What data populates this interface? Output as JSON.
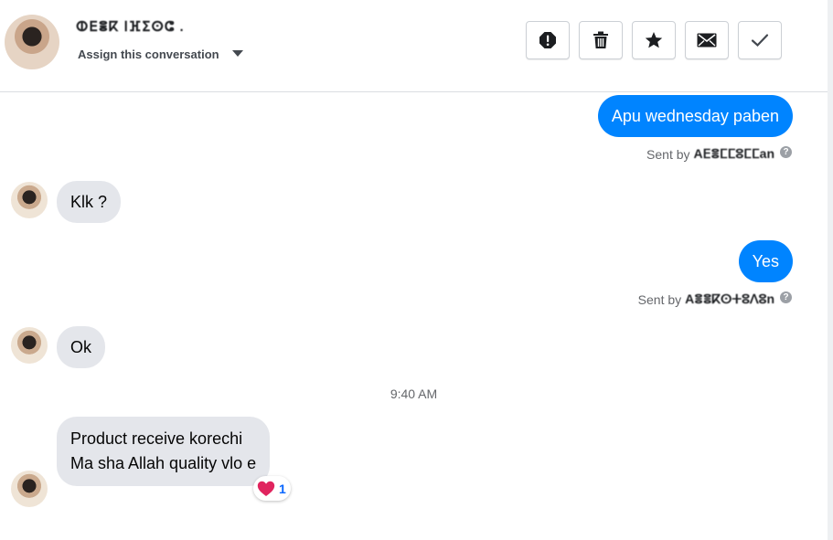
{
  "header": {
    "contact_name": "ⵀⴹⴻⴽ ⵏⴼⵉⵙⵛ .",
    "assign_label": "Assign this conversation"
  },
  "toolbar": {
    "icons": [
      "report-icon",
      "trash-icon",
      "star-icon",
      "envelope-icon",
      "check-icon"
    ]
  },
  "messages": [
    {
      "direction": "outgoing",
      "text": "Apu wednesday paben",
      "sent_by_label": "Sent by",
      "sent_by_name": "Aⴹⴻⵎⵎⵓⵎⵎan"
    },
    {
      "direction": "incoming",
      "text": "Klk ?"
    },
    {
      "direction": "outgoing",
      "text": "Yes",
      "sent_by_label": "Sent by",
      "sent_by_name": "Aⴻⴻⴽⵙⵜⵓⴷⵓn"
    },
    {
      "direction": "incoming",
      "text": "Ok"
    },
    {
      "direction": "timestamp",
      "text": "9:40 AM"
    },
    {
      "direction": "incoming",
      "lines": [
        "Product receive korechi",
        "Ma sha Allah quality vlo e"
      ],
      "reaction": {
        "emoji": "heart",
        "count": "1"
      }
    }
  ],
  "colors": {
    "outgoing_bubble": "#0084ff",
    "incoming_bubble": "#e4e6eb",
    "reaction_heart": "#e0245e"
  }
}
